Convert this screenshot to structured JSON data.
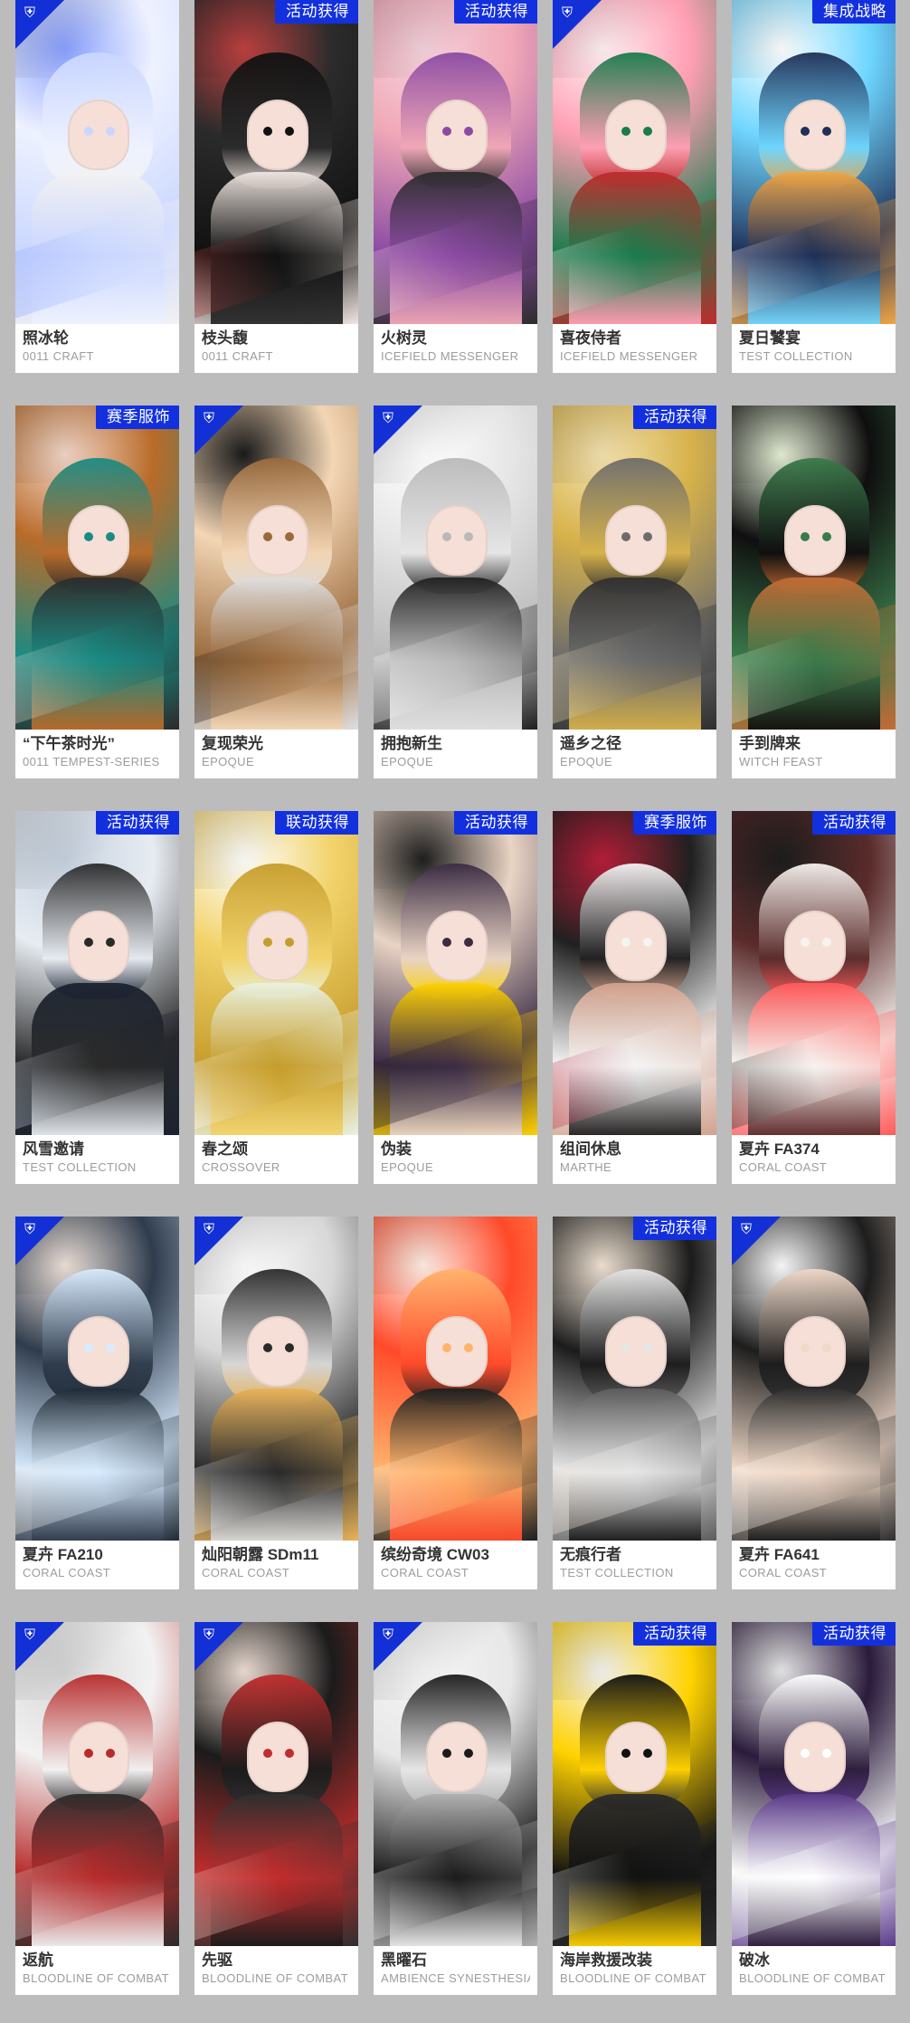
{
  "colors": {
    "page_bg": "#bcbcbc",
    "badge_blue": "#1330de",
    "badge_blue_dark": "#1230d6"
  },
  "cards": [
    {
      "title": "照冰轮",
      "subtitle": "0011 CRAFT",
      "badge": "corner",
      "tag": "",
      "palette": [
        "#eef2ff",
        "#c9d6ff",
        "#f2f2f2",
        "#8aa1ff"
      ]
    },
    {
      "title": "枝头馥",
      "subtitle": "0011 CRAFT",
      "badge": "",
      "tag": "活动获得",
      "palette": [
        "#2b2b2b",
        "#111111",
        "#f0e6e1",
        "#c04141"
      ]
    },
    {
      "title": "火树灵",
      "subtitle": "ICEFIELD MESSENGER",
      "badge": "",
      "tag": "活动获得",
      "palette": [
        "#f1a8b7",
        "#8a4aa3",
        "#2c2c2c",
        "#f6d2dc"
      ]
    },
    {
      "title": "喜夜侍者",
      "subtitle": "ICEFIELD MESSENGER",
      "badge": "corner",
      "tag": "",
      "palette": [
        "#ff9fb4",
        "#1a7b4c",
        "#c02b2b",
        "#fff1f3"
      ]
    },
    {
      "title": "夏日饕宴",
      "subtitle": "TEST COLLECTION",
      "badge": "",
      "tag": "集成战略",
      "palette": [
        "#6fd6ff",
        "#1f2f56",
        "#f0a545",
        "#ffffff"
      ]
    },
    {
      "title": "“下午茶时光”",
      "subtitle": "0011 TEMPEST-SERIES",
      "badge": "",
      "tag": "赛季服饰",
      "palette": [
        "#b96b2a",
        "#1a8b84",
        "#2b2b2b",
        "#f3d7c9"
      ]
    },
    {
      "title": "复现荣光",
      "subtitle": "EPOQUE",
      "badge": "corner",
      "tag": "",
      "palette": [
        "#f3d6b5",
        "#9a6a3c",
        "#dedede",
        "#1b1b1b"
      ]
    },
    {
      "title": "拥抱新生",
      "subtitle": "EPOQUE",
      "badge": "corner",
      "tag": "",
      "palette": [
        "#e6e6e6",
        "#b9b9b9",
        "#202020",
        "#ffffff"
      ]
    },
    {
      "title": "遥乡之径",
      "subtitle": "EPOQUE",
      "badge": "",
      "tag": "活动获得",
      "palette": [
        "#d7b24b",
        "#6c6c6c",
        "#2f2f2f",
        "#f4e2b0"
      ]
    },
    {
      "title": "手到牌来",
      "subtitle": "WITCH FEAST",
      "badge": "",
      "tag": "",
      "palette": [
        "#0f0f0f",
        "#3b7a4b",
        "#c46b34",
        "#e7f2d8"
      ]
    },
    {
      "title": "风雪邀请",
      "subtitle": "TEST COLLECTION",
      "badge": "",
      "tag": "活动获得",
      "palette": [
        "#e7ecf2",
        "#2a2a2a",
        "#1b2230",
        "#c7d2e0"
      ]
    },
    {
      "title": "春之颂",
      "subtitle": "CROSSOVER",
      "badge": "",
      "tag": "联动获得",
      "palette": [
        "#f2d36b",
        "#c69d2c",
        "#e9f2e1",
        "#ffffff"
      ]
    },
    {
      "title": "伪装",
      "subtitle": "EPOQUE",
      "badge": "",
      "tag": "活动获得",
      "palette": [
        "#e9d4c4",
        "#3b2b44",
        "#ffd200",
        "#1f1f1f"
      ]
    },
    {
      "title": "组间休息",
      "subtitle": "MARTHE",
      "badge": "",
      "tag": "赛季服饰",
      "palette": [
        "#202020",
        "#f4f4f4",
        "#d2a18c",
        "#b81f3a"
      ]
    },
    {
      "title": "夏卉 FA374",
      "subtitle": "CORAL COAST",
      "badge": "",
      "tag": "活动获得",
      "palette": [
        "#5a2b2b",
        "#f7f3ef",
        "#ff5a5a",
        "#1d1d1d"
      ]
    },
    {
      "title": "夏卉 FA210",
      "subtitle": "CORAL COAST",
      "badge": "corner",
      "tag": "",
      "palette": [
        "#2f3c4d",
        "#d8ecff",
        "#1f2a35",
        "#f0e3db"
      ]
    },
    {
      "title": "灿阳朝露 SDm11",
      "subtitle": "CORAL COAST",
      "badge": "corner",
      "tag": "",
      "palette": [
        "#d7d7d7",
        "#2a2a2a",
        "#e8b35a",
        "#ffffff"
      ]
    },
    {
      "title": "缤纷奇境 CW03",
      "subtitle": "CORAL COAST",
      "badge": "",
      "tag": "",
      "palette": [
        "#ff4a2a",
        "#ffb36b",
        "#1e1e1e",
        "#fff0e7"
      ]
    },
    {
      "title": "无痕行者",
      "subtitle": "TEST COLLECTION",
      "badge": "",
      "tag": "活动获得",
      "palette": [
        "#1b1b1b",
        "#e6e6e6",
        "#5c5c5c",
        "#f3e6d6"
      ]
    },
    {
      "title": "夏卉 FA641",
      "subtitle": "CORAL COAST",
      "badge": "corner",
      "tag": "",
      "palette": [
        "#1d1d1d",
        "#f0d9c8",
        "#2f2f2f",
        "#ffffff"
      ]
    },
    {
      "title": "返航",
      "subtitle": "BLOODLINE OF COMBAT",
      "badge": "corner",
      "tag": "",
      "palette": [
        "#f2f2f2",
        "#b72b2b",
        "#2b2b2b",
        "#d6d6d6"
      ]
    },
    {
      "title": "先驱",
      "subtitle": "BLOODLINE OF COMBAT",
      "badge": "corner",
      "tag": "",
      "palette": [
        "#1b1b1b",
        "#c12d2d",
        "#2f2f2f",
        "#f0e0d6"
      ]
    },
    {
      "title": "黑曜石",
      "subtitle": "AMBIENCE SYNESTHESIA",
      "badge": "corner",
      "tag": "",
      "palette": [
        "#e7e7e7",
        "#1b1b1b",
        "#b0b0b0",
        "#f6f6f6"
      ]
    },
    {
      "title": "海岸救援改装",
      "subtitle": "BLOODLINE OF COMBAT",
      "badge": "",
      "tag": "活动获得",
      "palette": [
        "#ffd200",
        "#111111",
        "#2b2b2b",
        "#f4f4f4"
      ]
    },
    {
      "title": "破冰",
      "subtitle": "BLOODLINE OF COMBAT",
      "badge": "",
      "tag": "活动获得",
      "palette": [
        "#2b1b3b",
        "#ffffff",
        "#5a3a8a",
        "#e9e9e9"
      ]
    }
  ]
}
